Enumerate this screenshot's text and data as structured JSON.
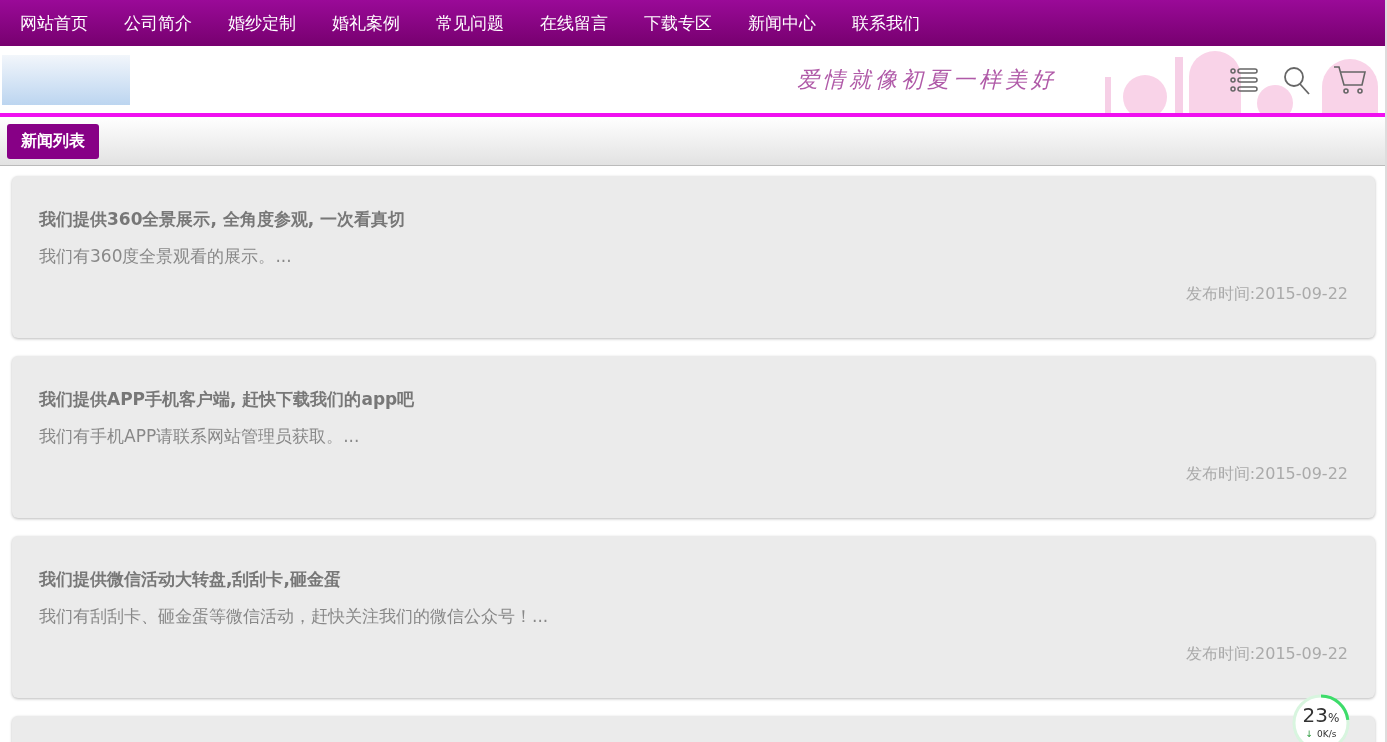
{
  "nav": {
    "items": [
      {
        "label": "网站首页"
      },
      {
        "label": "公司简介"
      },
      {
        "label": "婚纱定制"
      },
      {
        "label": "婚礼案例"
      },
      {
        "label": "常见问题"
      },
      {
        "label": "在线留言"
      },
      {
        "label": "下载专区"
      },
      {
        "label": "新闻中心"
      },
      {
        "label": "联系我们"
      }
    ]
  },
  "header": {
    "slogan": "爱情就像初夏一样美好"
  },
  "section": {
    "title": "新闻列表"
  },
  "news": [
    {
      "title": "我们提供360全景展示, 全角度参观, 一次看真切",
      "summary": "我们有360度全景观看的展示。...",
      "date": "发布时间:2015-09-22"
    },
    {
      "title": "我们提供APP手机客户端, 赶快下载我们的app吧",
      "summary": "我们有手机APP请联系网站管理员获取。...",
      "date": "发布时间:2015-09-22"
    },
    {
      "title": "我们提供微信活动大转盘,刮刮卡,砸金蛋",
      "summary": "我们有刮刮卡、砸金蛋等微信活动，赶快关注我们的微信公众号！...",
      "date": "发布时间:2015-09-22"
    }
  ],
  "speed_widget": {
    "percent": "23",
    "unit": "%",
    "level": 0.23,
    "arrow": "↓",
    "speed": "0K/s"
  }
}
